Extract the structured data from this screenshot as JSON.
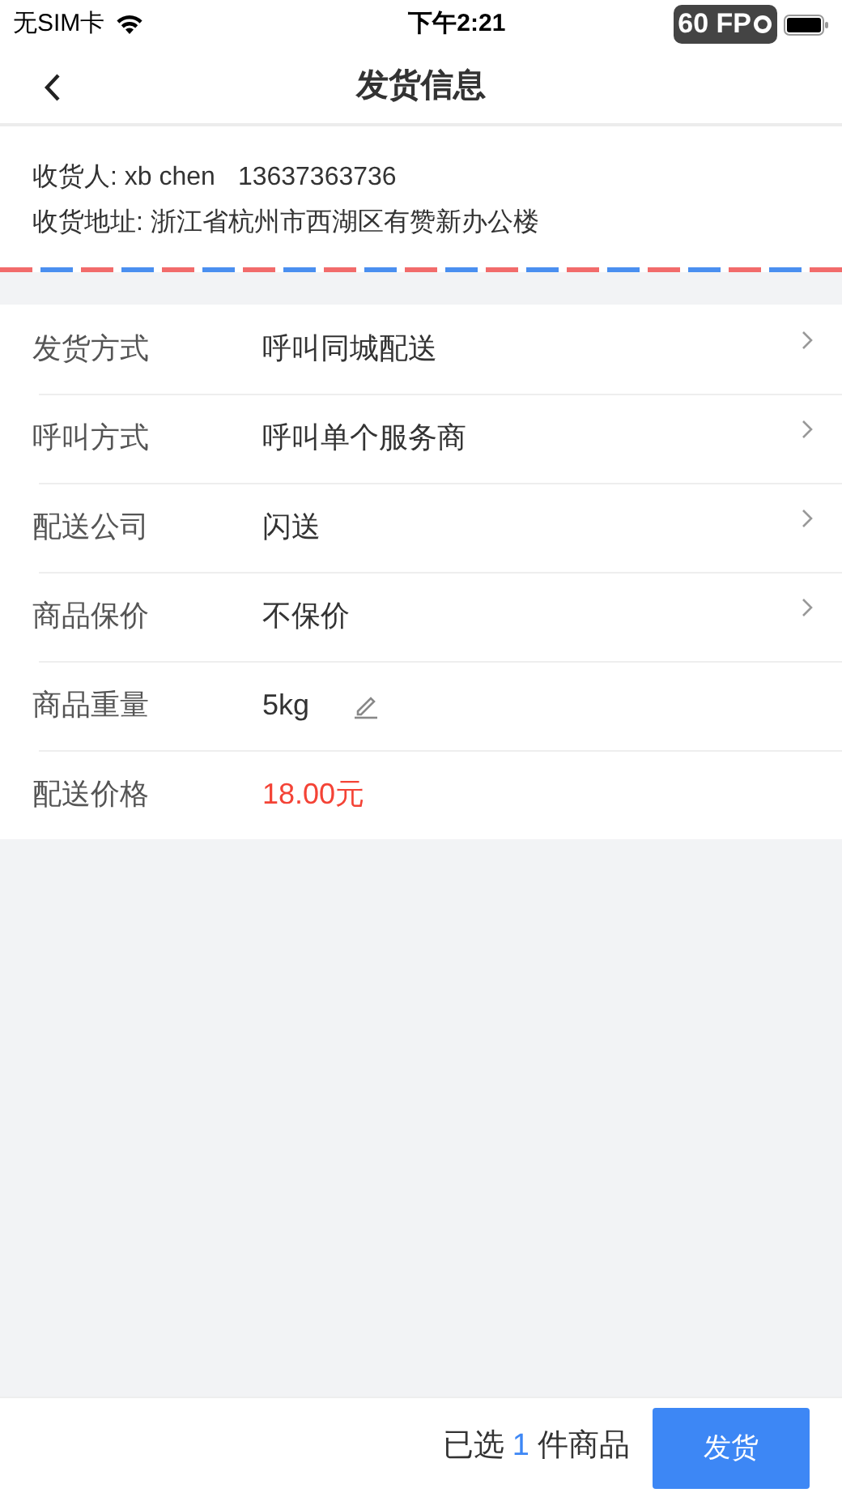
{
  "status_bar": {
    "carrier": "无SIM卡",
    "time": "下午2:21",
    "fps": "60 FP"
  },
  "nav": {
    "title": "发货信息"
  },
  "recipient": {
    "name_line": "收货人: xb chen",
    "phone": "13637363736",
    "address": "收货地址: 浙江省杭州市西湖区有赞新办公楼"
  },
  "fields": [
    {
      "label": "发货方式",
      "value": "呼叫同城配送",
      "kind": "select"
    },
    {
      "label": "呼叫方式",
      "value": "呼叫单个服务商",
      "kind": "select"
    },
    {
      "label": "配送公司",
      "value": "闪送",
      "kind": "select"
    },
    {
      "label": "商品保价",
      "value": "不保价",
      "kind": "select"
    },
    {
      "label": "商品重量",
      "value": "5kg",
      "kind": "editable"
    },
    {
      "label": "配送价格",
      "value": "18.00元",
      "kind": "price"
    }
  ],
  "footer": {
    "selected_prefix": "已选",
    "selected_count": "1",
    "selected_suffix": "件商品",
    "submit": "发货"
  }
}
